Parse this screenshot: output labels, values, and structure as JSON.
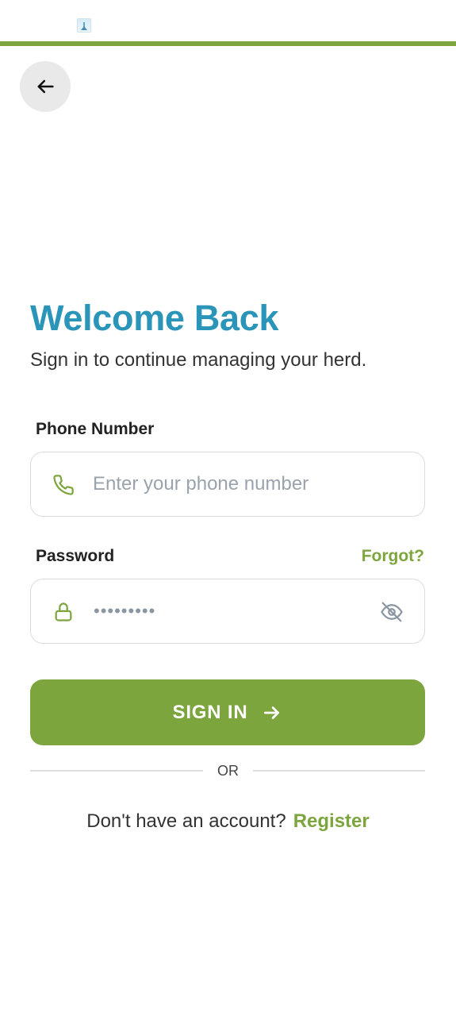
{
  "colors": {
    "accent_green": "#7da53d",
    "title_blue": "#2a95b8",
    "back_button_bg": "#e9e9e9"
  },
  "header": {
    "back_icon": "arrow-left-icon"
  },
  "welcome": {
    "title": "Welcome Back",
    "subtitle": "Sign in to continue managing your herd."
  },
  "phone": {
    "label": "Phone Number",
    "placeholder": "Enter your phone number",
    "value": "",
    "icon": "phone-icon"
  },
  "password": {
    "label": "Password",
    "forgot_label": "Forgot?",
    "masked_value": "•••••••••",
    "icon": "lock-icon",
    "toggle_icon": "eye-off-icon"
  },
  "signin": {
    "label": "SIGN IN",
    "icon": "arrow-right-icon"
  },
  "divider": {
    "text": "OR"
  },
  "register": {
    "prompt": "Don't have an account?",
    "link_label": "Register"
  }
}
